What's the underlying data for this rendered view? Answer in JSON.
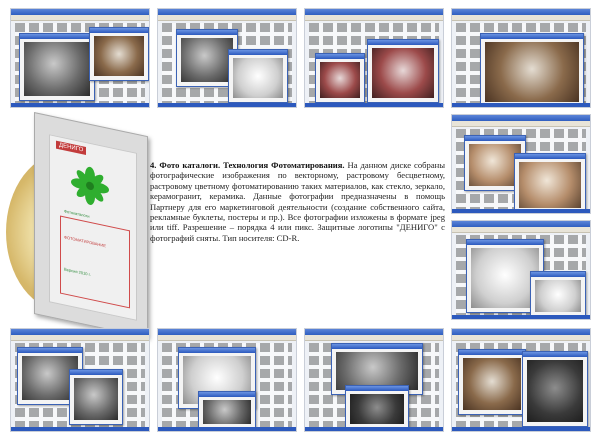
{
  "description": {
    "heading": "4. Фото каталоги. Технология Фотоматирования.",
    "body": "На данном диске собраны фотографические изображения по векторному, растровому бесцветному, растровому цветному фотоматированию таких материалов, как стекло, зеркало, керамогранит, керамика. Данные фотографии предназначены в помощь Партнеру для его маркетинговой деятельности (создание собственного сайта, рекламные буклеты, постеры и пр.). Все фотографии изложены в формате jpeg или tiff. Разрешение – порядка 4 или пикс. Защитные логотипы \"ДЕНИГО\" с фотографий сняты. Тип носителя: CD-R."
  },
  "cd_cover": {
    "title": "ДЕНИГО",
    "line1": "Фотокаталоги",
    "line2": "ФОТОМАТИРОВАНИЕ",
    "line3": "Версия 2010 г.",
    "colors": {
      "title_bg": "#c23b3b",
      "flower": "#2fae2f",
      "frame": "#d04b4b"
    }
  },
  "screenshots": [
    {
      "name": "screenshot-top-1",
      "photo": "gray"
    },
    {
      "name": "screenshot-top-2",
      "photo": "gray"
    },
    {
      "name": "screenshot-top-3",
      "photo": "red"
    },
    {
      "name": "screenshot-top-4",
      "photo": "brown"
    },
    {
      "name": "screenshot-right-1",
      "photo": "warm"
    },
    {
      "name": "screenshot-right-2",
      "photo": "light"
    },
    {
      "name": "screenshot-bottom-1",
      "photo": "gray"
    },
    {
      "name": "screenshot-bottom-2",
      "photo": "light"
    },
    {
      "name": "screenshot-bottom-3",
      "photo": "dark"
    },
    {
      "name": "screenshot-bottom-4",
      "photo": "brown"
    }
  ]
}
